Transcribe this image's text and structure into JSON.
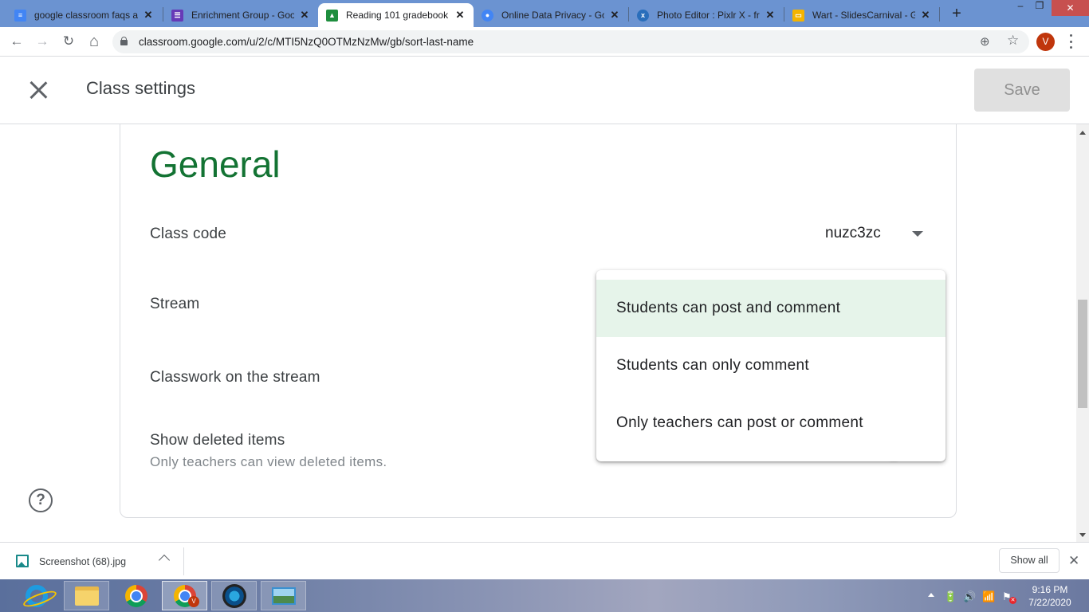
{
  "browser": {
    "tabs": [
      {
        "label": "google classroom faqs a",
        "icon": "google-docs-icon",
        "icon_color": "#4285f4",
        "active": false
      },
      {
        "label": "Enrichment Group - Goo",
        "icon": "google-forms-icon",
        "icon_color": "#673ab7",
        "active": false
      },
      {
        "label": "Reading 101 gradebook",
        "icon": "google-classroom-icon",
        "icon_color": "#1e8e3e",
        "active": true
      },
      {
        "label": "Online Data Privacy - Go",
        "icon": "google-sites-icon",
        "icon_color": "#4285f4",
        "active": false
      },
      {
        "label": "Photo Editor : Pixlr X - fr",
        "icon": "pixlr-icon",
        "icon_color": "#2a6ebb",
        "active": false
      },
      {
        "label": "Wart - SlidesCarnival - G",
        "icon": "google-slides-icon",
        "icon_color": "#f4b400",
        "active": false
      }
    ],
    "tab_close_glyph": "✕",
    "new_tab_glyph": "+",
    "window_controls": {
      "minimize": "–",
      "restore": "❐",
      "close": "✕"
    },
    "url_host": "classroom.google.com",
    "url_path": "/u/2/c/MTI5NzQ0OTMzNzMw/gb/sort-last-name",
    "profile_initial": "V",
    "nav_glyphs": {
      "back": "←",
      "forward": "→",
      "reload": "↻",
      "home": "⌂",
      "zoom": "⊕",
      "bookmark": "☆"
    }
  },
  "header": {
    "title": "Class settings",
    "save_label": "Save"
  },
  "general": {
    "section_title": "General",
    "rows": {
      "class_code": {
        "label": "Class code",
        "value": "nuzc3zc"
      },
      "stream": {
        "label": "Stream"
      },
      "classwork_stream": {
        "label": "Classwork on the stream"
      },
      "show_deleted": {
        "label": "Show deleted items",
        "description": "Only teachers can view deleted items.",
        "enabled": false
      }
    }
  },
  "stream_menu": {
    "options": [
      {
        "label": "Students can post and comment",
        "selected": true
      },
      {
        "label": "Students can only comment",
        "selected": false
      },
      {
        "label": "Only teachers can post or comment",
        "selected": false
      }
    ]
  },
  "help": {
    "glyph": "?"
  },
  "downloads": {
    "file_name": "Screenshot (68).jpg",
    "show_all_label": "Show all",
    "close_glyph": "✕"
  },
  "taskbar": {
    "apps": [
      "internet-explorer",
      "file-explorer",
      "chrome",
      "chrome-profile-v",
      "media-player",
      "photos"
    ],
    "chrome_badge": "V",
    "tray_glyphs": {
      "power": "🔋",
      "volume": "🔊",
      "signal": "📶",
      "flag": "⚑",
      "flag_badge": "✕"
    },
    "time": "9:16 PM",
    "date": "7/22/2020"
  }
}
